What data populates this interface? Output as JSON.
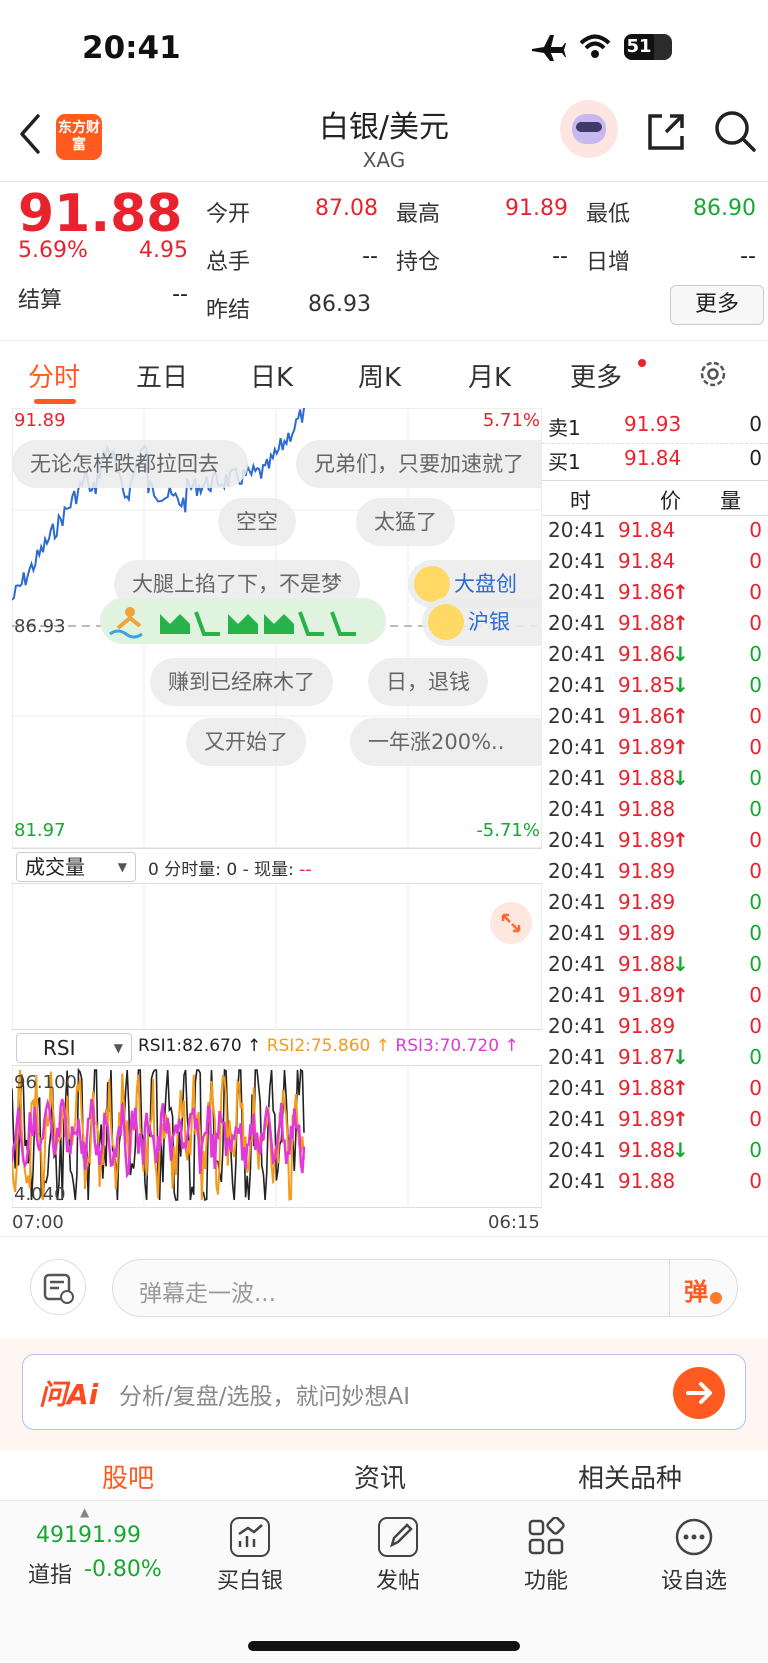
{
  "status_bar": {
    "time": "20:41",
    "battery": "51"
  },
  "header": {
    "title": "白银/美元",
    "subtitle": "XAG",
    "logo_text": "东方财富"
  },
  "quote": {
    "last": "91.88",
    "change_pct": "5.69%",
    "change": "4.95",
    "settle_label": "结算",
    "settle_value": "--",
    "fields": [
      {
        "label": "今开",
        "value": "87.08",
        "color": "red"
      },
      {
        "label": "最高",
        "value": "91.89",
        "color": "red"
      },
      {
        "label": "最低",
        "value": "86.90",
        "color": "green"
      },
      {
        "label": "总手",
        "value": "--",
        "color": "black"
      },
      {
        "label": "持仓",
        "value": "--",
        "color": "black"
      },
      {
        "label": "日增",
        "value": "--",
        "color": "black"
      },
      {
        "label": "昨结",
        "value": "86.93",
        "color": "black"
      }
    ],
    "more_button": "更多"
  },
  "tabs": [
    "分时",
    "五日",
    "日K",
    "周K",
    "月K",
    "更多"
  ],
  "active_tab": "分时",
  "chart": {
    "price_high": "91.89",
    "price_base": "86.93",
    "price_low": "81.97",
    "pct_high": "5.71%",
    "pct_low": "-5.71%",
    "volume_selector": "成交量",
    "volume_info_prefix": "0 分时量: 0 - 现量: ",
    "volume_info_value": "--",
    "rsi_selector": "RSI",
    "rsi1": "RSI1:82.670 ↑",
    "rsi2": "RSI2:75.860 ↑",
    "rsi3": "RSI3:70.720 ↑",
    "rsi_high": "96.100",
    "rsi_low": "4.040",
    "time_start": "07:00",
    "time_end": "06:15"
  },
  "barrages": [
    {
      "text": "无论怎样跌都拉回去"
    },
    {
      "text": "兄弟们，只要加速就了"
    },
    {
      "text": "空空"
    },
    {
      "text": "太猛了"
    },
    {
      "text": "大腿上掐了下，不是梦"
    },
    {
      "text": "大盘创"
    },
    {
      "text": "沪银"
    },
    {
      "text": "赚到已经麻木了"
    },
    {
      "text": "日，退钱"
    },
    {
      "text": "又开始了"
    },
    {
      "text": "一年涨200%.."
    }
  ],
  "order_book": {
    "ask": {
      "label": "卖1",
      "price": "91.93",
      "qty": "0"
    },
    "bid": {
      "label": "买1",
      "price": "91.84",
      "qty": "0"
    }
  },
  "trades_header": {
    "time": "时",
    "price": "价",
    "qty": "量"
  },
  "trades": [
    {
      "time": "20:41",
      "price": "91.84",
      "dir": "",
      "qty": "0",
      "color": "red"
    },
    {
      "time": "20:41",
      "price": "91.84",
      "dir": "",
      "qty": "0",
      "color": "red"
    },
    {
      "time": "20:41",
      "price": "91.86",
      "dir": "↑",
      "qty": "0",
      "color": "red"
    },
    {
      "time": "20:41",
      "price": "91.88",
      "dir": "↑",
      "qty": "0",
      "color": "red"
    },
    {
      "time": "20:41",
      "price": "91.86",
      "dir": "↓",
      "qty": "0",
      "color": "green"
    },
    {
      "time": "20:41",
      "price": "91.85",
      "dir": "↓",
      "qty": "0",
      "color": "green"
    },
    {
      "time": "20:41",
      "price": "91.86",
      "dir": "↑",
      "qty": "0",
      "color": "red"
    },
    {
      "time": "20:41",
      "price": "91.89",
      "dir": "↑",
      "qty": "0",
      "color": "red"
    },
    {
      "time": "20:41",
      "price": "91.88",
      "dir": "↓",
      "qty": "0",
      "color": "green"
    },
    {
      "time": "20:41",
      "price": "91.88",
      "dir": "",
      "qty": "0",
      "color": "green"
    },
    {
      "time": "20:41",
      "price": "91.89",
      "dir": "↑",
      "qty": "0",
      "color": "red"
    },
    {
      "time": "20:41",
      "price": "91.89",
      "dir": "",
      "qty": "0",
      "color": "red"
    },
    {
      "time": "20:41",
      "price": "91.89",
      "dir": "",
      "qty": "0",
      "color": "green"
    },
    {
      "time": "20:41",
      "price": "91.89",
      "dir": "",
      "qty": "0",
      "color": "green"
    },
    {
      "time": "20:41",
      "price": "91.88",
      "dir": "↓",
      "qty": "0",
      "color": "green"
    },
    {
      "time": "20:41",
      "price": "91.89",
      "dir": "↑",
      "qty": "0",
      "color": "red"
    },
    {
      "time": "20:41",
      "price": "91.89",
      "dir": "",
      "qty": "0",
      "color": "red"
    },
    {
      "time": "20:41",
      "price": "91.87",
      "dir": "↓",
      "qty": "0",
      "color": "green"
    },
    {
      "time": "20:41",
      "price": "91.88",
      "dir": "↑",
      "qty": "0",
      "color": "red"
    },
    {
      "time": "20:41",
      "price": "91.89",
      "dir": "↑",
      "qty": "0",
      "color": "red"
    },
    {
      "time": "20:41",
      "price": "91.88",
      "dir": "↓",
      "qty": "0",
      "color": "green"
    },
    {
      "time": "20:41",
      "price": "91.88",
      "dir": "",
      "qty": "0",
      "color": "red"
    }
  ],
  "danmu": {
    "placeholder": "弹幕走一波...",
    "button": "弹"
  },
  "ai": {
    "brand": "问Ai",
    "placeholder": "分析/复盘/选股，就问妙想AI"
  },
  "sub_tabs": [
    "股吧",
    "资讯",
    "相关品种"
  ],
  "bottom_nav": {
    "index_value": "49191.99",
    "index_name": "道指",
    "index_change": "-0.80%",
    "items": [
      "买白银",
      "发帖",
      "功能",
      "设自选"
    ]
  },
  "colors": {
    "up": "#e8232e",
    "down": "#17a832",
    "accent": "#ff5a1f",
    "line": "#2e6bd1"
  }
}
